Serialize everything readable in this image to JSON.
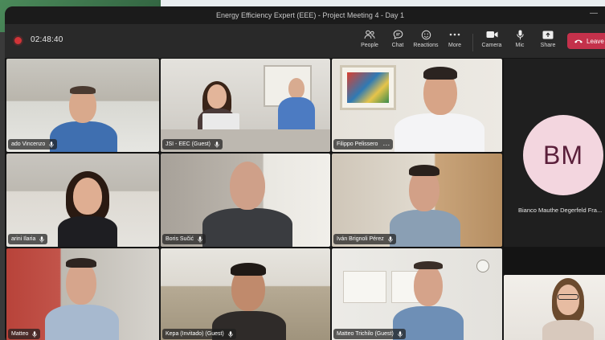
{
  "window": {
    "title": "Energy Efficiency Expert (EEE) - Project Meeting 4 - Day 1",
    "minimize_glyph": "—"
  },
  "toolbar": {
    "timer": "02:48:40",
    "people_label": "People",
    "chat_label": "Chat",
    "reactions_label": "Reactions",
    "more_label": "More",
    "camera_label": "Camera",
    "mic_label": "Mic",
    "share_label": "Share",
    "leave_label": "Leave"
  },
  "colors": {
    "recording": "#d13438",
    "leave": "#c4314b",
    "avatar_bg": "#f3d6df",
    "avatar_fg": "#5a1f3a"
  },
  "participants": [
    {
      "name": "ado Vincenzo",
      "mic_icon": "mic-icon"
    },
    {
      "name": "JSI - EEC (Guest)",
      "mic_icon": "mic-icon"
    },
    {
      "name": "Filippo Pelissero",
      "menu": "···"
    },
    {
      "name": "arini Ilaria",
      "mic_icon": "mic-icon"
    },
    {
      "name": "Boris Sučić",
      "mic_icon": "mic-icon"
    },
    {
      "name": "Iván Brignoli Pérez",
      "mic_icon": "mic-icon"
    },
    {
      "name": "Matteo",
      "mic_icon": "mic-icon"
    },
    {
      "name": "Kepa (Invitado) (Guest)",
      "mic_icon": "mic-icon"
    },
    {
      "name": "Matteo Trichilo (Guest)",
      "mic_icon": "mic-icon"
    }
  ],
  "side_participant": {
    "initials": "BM",
    "name": "Bianco Mauthe Degerfeld Fra..."
  }
}
